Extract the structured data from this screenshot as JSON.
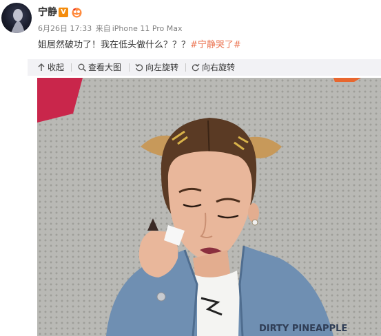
{
  "post": {
    "author": "宁静",
    "verified_badge": "V",
    "date": "6月26日 17:33",
    "source_prefix": "来自",
    "source": "iPhone 11 Pro Max",
    "text_main": "姐居然破功了！我在低头做什么？？？",
    "hashtag": "#宁静哭了#"
  },
  "toolbar": {
    "collapse": "收起",
    "view_large": "查看大图",
    "rotate_left": "向左旋转",
    "rotate_right": "向右旋转"
  },
  "photo": {
    "jacket_text": "DIRTY PINEAPPLE"
  },
  "colors": {
    "hashtag": "#eb7350",
    "toolbar_bg": "#f2f2f5",
    "verified": "#f48c0d"
  },
  "icons": [
    "collapse-arrow-icon",
    "magnifier-icon",
    "rotate-left-icon",
    "rotate-right-icon"
  ]
}
